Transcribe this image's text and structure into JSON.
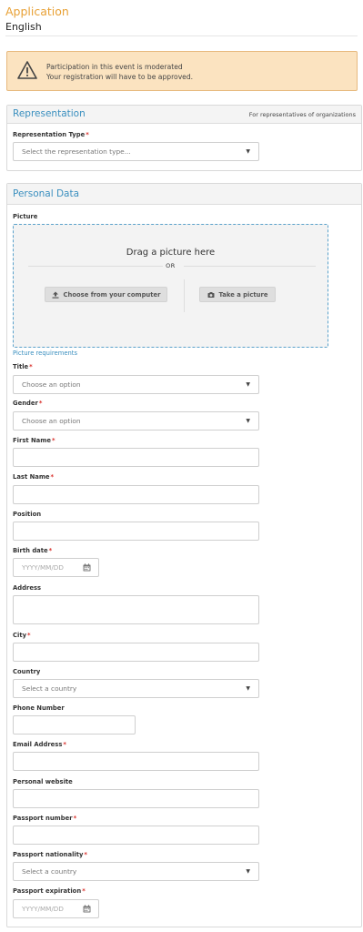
{
  "header": {
    "title": "Application",
    "language": "English"
  },
  "alert": {
    "icon": "warning-icon",
    "line1": "Participation in this event is moderated",
    "line2": "Your registration will have to be approved."
  },
  "representation": {
    "title": "Representation",
    "aside": "For representatives of organizations",
    "type_label": "Representation Type",
    "type_placeholder": "Select the representation type..."
  },
  "personal": {
    "title": "Personal Data",
    "picture_label": "Picture",
    "drop_title": "Drag a picture here",
    "or": "OR",
    "choose_button": "Choose from your computer",
    "take_button": "Take a picture",
    "requirements_link": "Picture requirements",
    "title_label": "Title",
    "title_placeholder": "Choose an option",
    "gender_label": "Gender",
    "gender_placeholder": "Choose an option",
    "first_name_label": "First Name",
    "last_name_label": "Last Name",
    "position_label": "Position",
    "birth_label": "Birth date",
    "birth_placeholder": "YYYY/MM/DD",
    "address_label": "Address",
    "city_label": "City",
    "country_label": "Country",
    "country_placeholder": "Select a country",
    "phone_label": "Phone Number",
    "email_label": "Email Address",
    "website_label": "Personal website",
    "passport_number_label": "Passport number",
    "passport_nationality_label": "Passport nationality",
    "passport_nationality_placeholder": "Select a country",
    "passport_expiration_label": "Passport expiration",
    "passport_expiration_placeholder": "YYYY/MM/DD"
  },
  "colors": {
    "accent_orange": "#e8a136",
    "link_blue": "#3a8fbf",
    "required_red": "#d9302b",
    "alert_bg": "#fbe3c0"
  }
}
